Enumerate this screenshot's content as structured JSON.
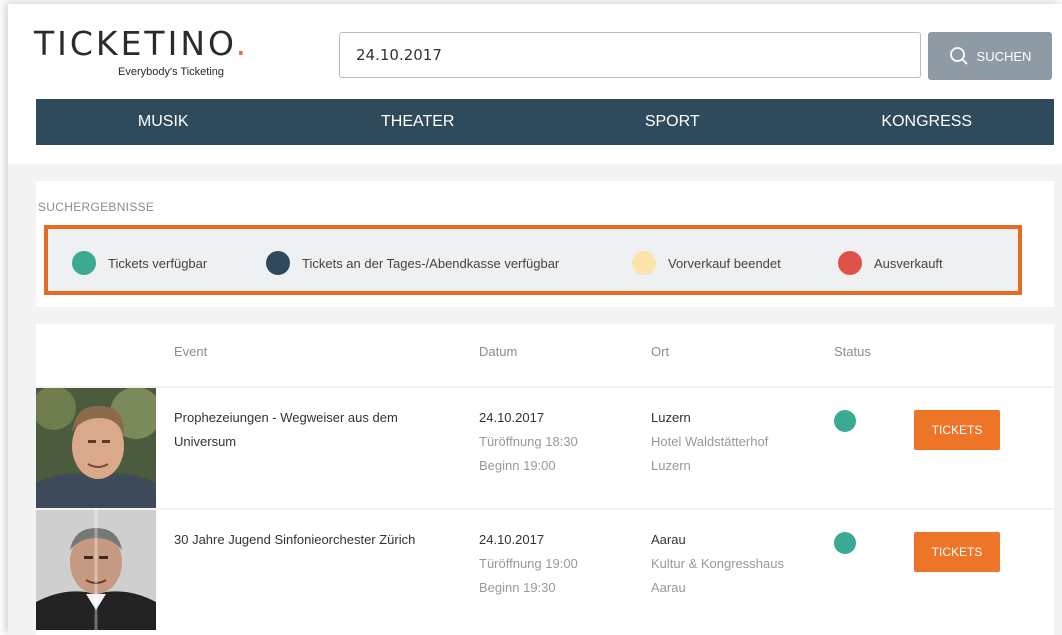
{
  "logo": {
    "wordmark": "TICKETINO",
    "dot": ".",
    "tagline": "Everybody's Ticketing"
  },
  "search": {
    "value": "24.10.2017",
    "button_label": "SUCHEN",
    "icon": "search-icon"
  },
  "nav": {
    "items": [
      "MUSIK",
      "THEATER",
      "SPORT",
      "KONGRESS"
    ]
  },
  "legend": {
    "title": "SUCHERGEBNISSE",
    "items": [
      {
        "label": "Tickets verfügbar",
        "color": "#3aaa93"
      },
      {
        "label": "Tickets an der Tages-/Abendkasse verfügbar",
        "color": "#2e4a5c"
      },
      {
        "label": "Vorverkauf beendet",
        "color": "#fde3ac"
      },
      {
        "label": "Ausverkauft",
        "color": "#e05149"
      }
    ]
  },
  "table": {
    "headers": {
      "event": "Event",
      "date": "Datum",
      "place": "Ort",
      "status": "Status"
    },
    "rows": [
      {
        "event_line1": "Prophezeiungen - Wegweiser aus dem",
        "event_line2": "Universum",
        "date": "24.10.2017",
        "doors": "Türöffnung 18:30",
        "start": "Beginn 19:00",
        "city": "Luzern",
        "venue": "Hotel Waldstätterhof",
        "venue_city": "Luzern",
        "status_color": "#3aaa93",
        "button": "TICKETS"
      },
      {
        "event_line1": "30 Jahre Jugend Sinfonieorchester Zürich",
        "event_line2": "",
        "date": "24.10.2017",
        "doors": "Türöffnung 19:00",
        "start": "Beginn 19:30",
        "city": "Aarau",
        "venue": "Kultur & Kongresshaus",
        "venue_city": "Aarau",
        "status_color": "#3aaa93",
        "button": "TICKETS"
      }
    ]
  }
}
